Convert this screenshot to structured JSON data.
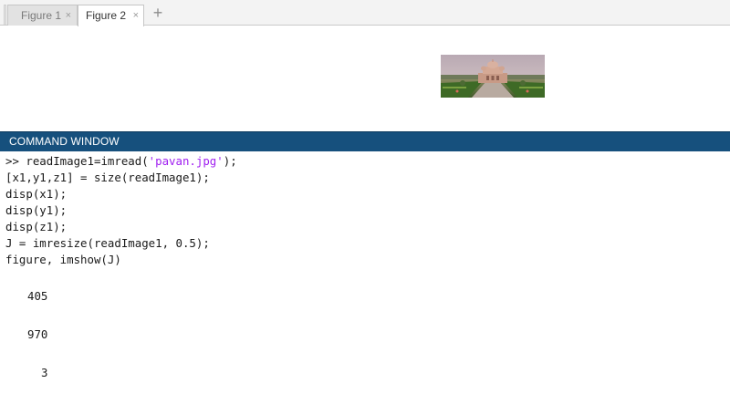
{
  "tabs": [
    {
      "label": "Figure 1",
      "close": "×",
      "active": false
    },
    {
      "label": "Figure 2",
      "close": "×",
      "active": true
    }
  ],
  "add_tab": "+",
  "figure": {
    "image_icon": "photo-thumbnail"
  },
  "command_window": {
    "title": "COMMAND WINDOW",
    "prompt": ">>",
    "code_lines": [
      {
        "pre": " readImage1=imread(",
        "str": "'pavan.jpg'",
        "post": ");"
      },
      {
        "pre": "[x1,y1,z1] = size(readImage1);",
        "str": "",
        "post": ""
      },
      {
        "pre": "disp(x1);",
        "str": "",
        "post": ""
      },
      {
        "pre": "disp(y1);",
        "str": "",
        "post": ""
      },
      {
        "pre": "disp(z1);",
        "str": "",
        "post": ""
      },
      {
        "pre": "J = imresize(readImage1, 0.5);",
        "str": "",
        "post": ""
      },
      {
        "pre": "figure, imshow(J)",
        "str": "",
        "post": ""
      }
    ],
    "outputs": [
      "405",
      "970",
      "3"
    ]
  },
  "colors": {
    "header_bg": "#16507d",
    "string_color": "#a020f0"
  }
}
